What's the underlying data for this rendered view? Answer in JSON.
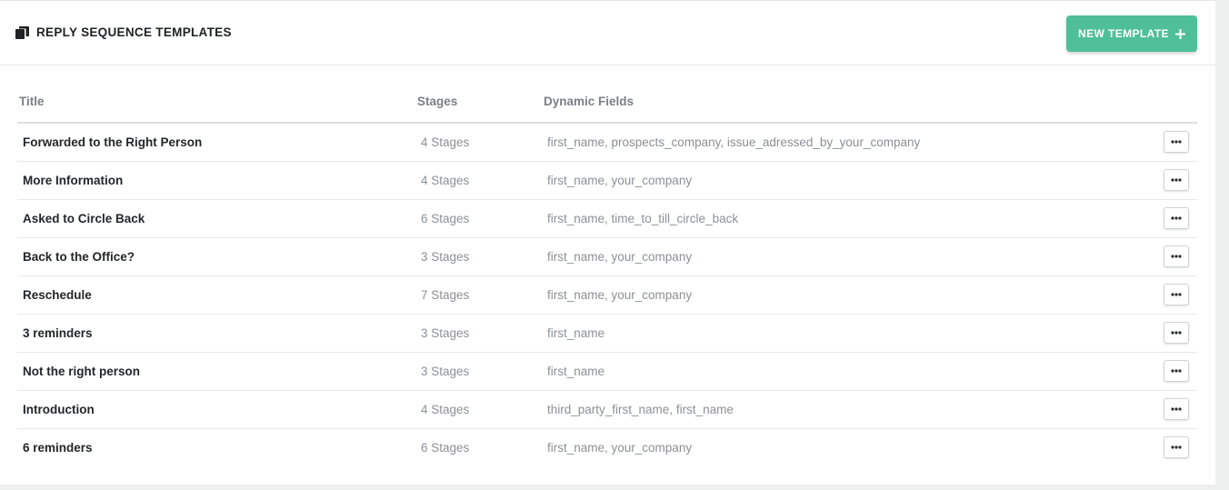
{
  "header": {
    "title": "REPLY SEQUENCE TEMPLATES",
    "icon": "copy-icon",
    "new_button_label": "NEW TEMPLATE",
    "new_button_icon": "plus-icon",
    "accent_color": "#4fbf99"
  },
  "table": {
    "columns": {
      "title": "Title",
      "stages": "Stages",
      "fields": "Dynamic Fields"
    },
    "row_action_icon": "more-horizontal-icon",
    "rows": [
      {
        "title": "Forwarded to the Right Person",
        "stages": "4 Stages",
        "fields": "first_name, prospects_company, issue_adressed_by_your_company"
      },
      {
        "title": "More Information",
        "stages": "4 Stages",
        "fields": "first_name, your_company"
      },
      {
        "title": "Asked to Circle Back",
        "stages": "6 Stages",
        "fields": "first_name, time_to_till_circle_back"
      },
      {
        "title": "Back to the Office?",
        "stages": "3 Stages",
        "fields": "first_name, your_company"
      },
      {
        "title": "Reschedule",
        "stages": "7 Stages",
        "fields": "first_name, your_company"
      },
      {
        "title": "3 reminders",
        "stages": "3 Stages",
        "fields": "first_name"
      },
      {
        "title": "Not the right person",
        "stages": "3 Stages",
        "fields": "first_name"
      },
      {
        "title": "Introduction",
        "stages": "4 Stages",
        "fields": "third_party_first_name, first_name"
      },
      {
        "title": "6 reminders",
        "stages": "6 Stages",
        "fields": "first_name, your_company"
      }
    ]
  }
}
